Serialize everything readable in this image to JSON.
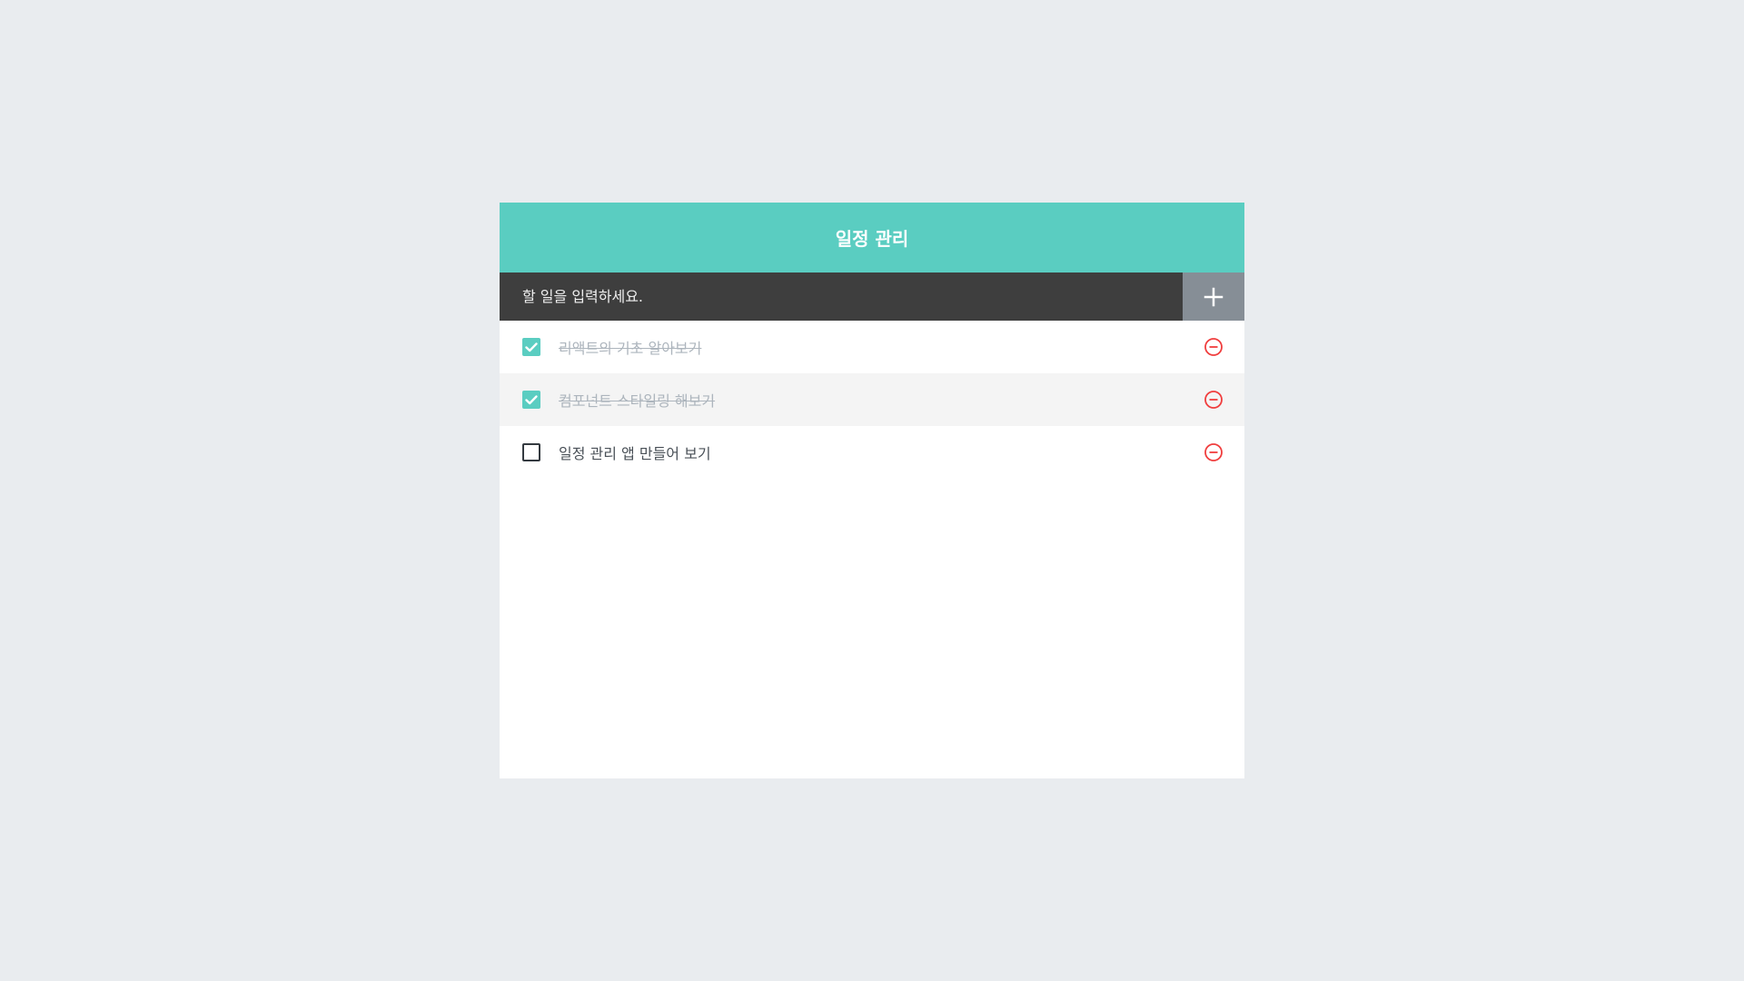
{
  "app": {
    "title": "일정 관리"
  },
  "insert": {
    "placeholder": "할 일을 입력하세요.",
    "add_icon": "plus-icon"
  },
  "todos": [
    {
      "text": "리액트의 기초 알아보기",
      "checked": true
    },
    {
      "text": "컴포넌트 스타일링 해보기",
      "checked": true
    },
    {
      "text": "일정 관리 앱 만들어 보기",
      "checked": false
    }
  ],
  "colors": {
    "accent": "#5acdc1",
    "input_bar": "#3e3e3e",
    "add_button": "#868e96",
    "remove": "#f03e3e"
  }
}
